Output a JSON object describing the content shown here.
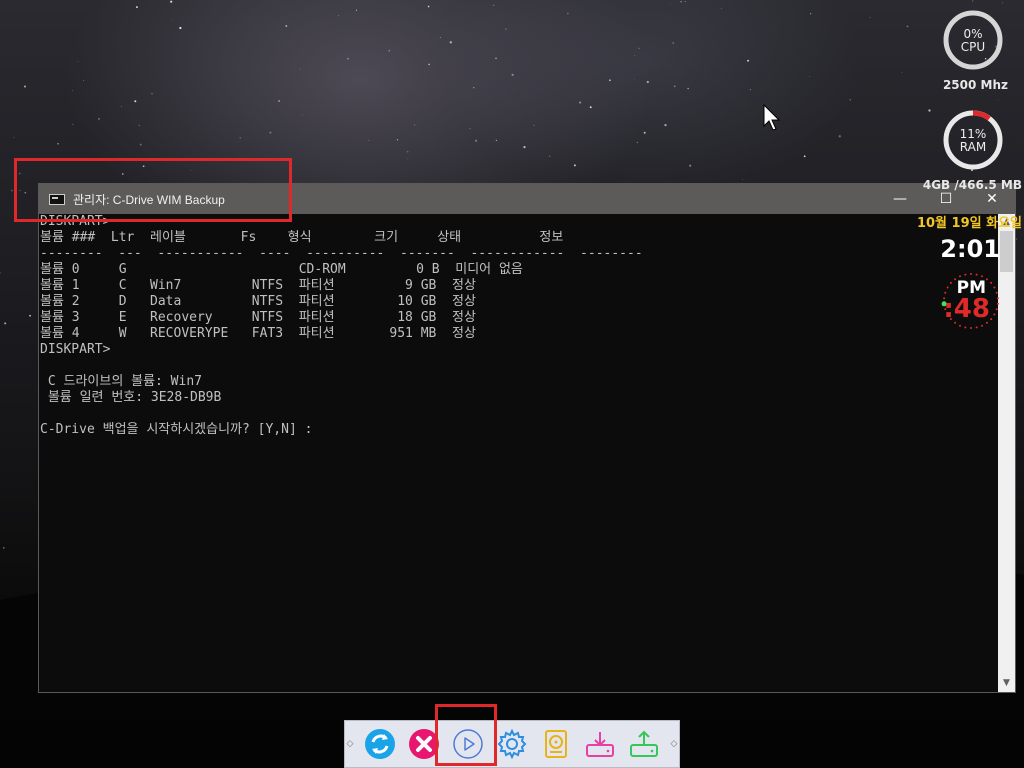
{
  "widget": {
    "cpu": {
      "percent_label": "0%",
      "label": "CPU",
      "percent": 0,
      "freq": "2500 Mhz"
    },
    "ram": {
      "percent_label": "11%",
      "label": "RAM",
      "percent": 11,
      "size": "4GB /466.5 MB"
    },
    "date": "10월 19일 화요일",
    "time": "2:01",
    "ampm": "PM",
    "seconds": ":48",
    "accent_color": "#e02a2a",
    "date_color": "#f3c623"
  },
  "window": {
    "title": "관리자:  C-Drive WIM Backup",
    "icon": "console-icon",
    "controls": {
      "minimize": "—",
      "maximize": "☐",
      "close": "✕"
    },
    "console_lines": [
      "DISKPART>",
      "볼륨 ###  Ltr  레이블       Fs    형식        크기     상태          정보",
      "--------  ---  -----------  ----  ----------  -------  ------------  --------",
      "볼륨 0     G                      CD-ROM         0 B  미디어 없음",
      "볼륨 1     C   Win7         NTFS  파티션         9 GB  정상",
      "볼륨 2     D   Data         NTFS  파티션        10 GB  정상",
      "볼륨 3     E   Recovery     NTFS  파티션        18 GB  정상",
      "볼륨 4     W   RECOVERYPE   FAT3  파티션       951 MB  정상",
      "DISKPART>",
      "",
      " C 드라이브의 볼륨: Win7",
      " 볼륨 일련 번호: 3E28-DB9B",
      "",
      "C-Drive 백업을 시작하시겠습니까? [Y,N] :"
    ]
  },
  "toolbar": {
    "buttons": [
      {
        "name": "refresh-button",
        "icon": "refresh-icon",
        "color": "#1aa3e8"
      },
      {
        "name": "cancel-button",
        "icon": "close-circle-icon",
        "color": "#e8166e"
      },
      {
        "name": "play-button",
        "icon": "play-icon",
        "color": "#4e7bd8"
      },
      {
        "name": "settings-button",
        "icon": "gear-icon",
        "color": "#2e8fe0"
      },
      {
        "name": "backup-drive-button",
        "icon": "hard-drive-icon",
        "color": "#e8b318"
      },
      {
        "name": "download-drive-button",
        "icon": "download-drive-icon",
        "color": "#e83fa6"
      },
      {
        "name": "upload-drive-button",
        "icon": "upload-drive-icon",
        "color": "#34c759"
      }
    ],
    "left_arrow": "◇",
    "right_arrow": "◇"
  },
  "highlight_color": "#e0282b"
}
